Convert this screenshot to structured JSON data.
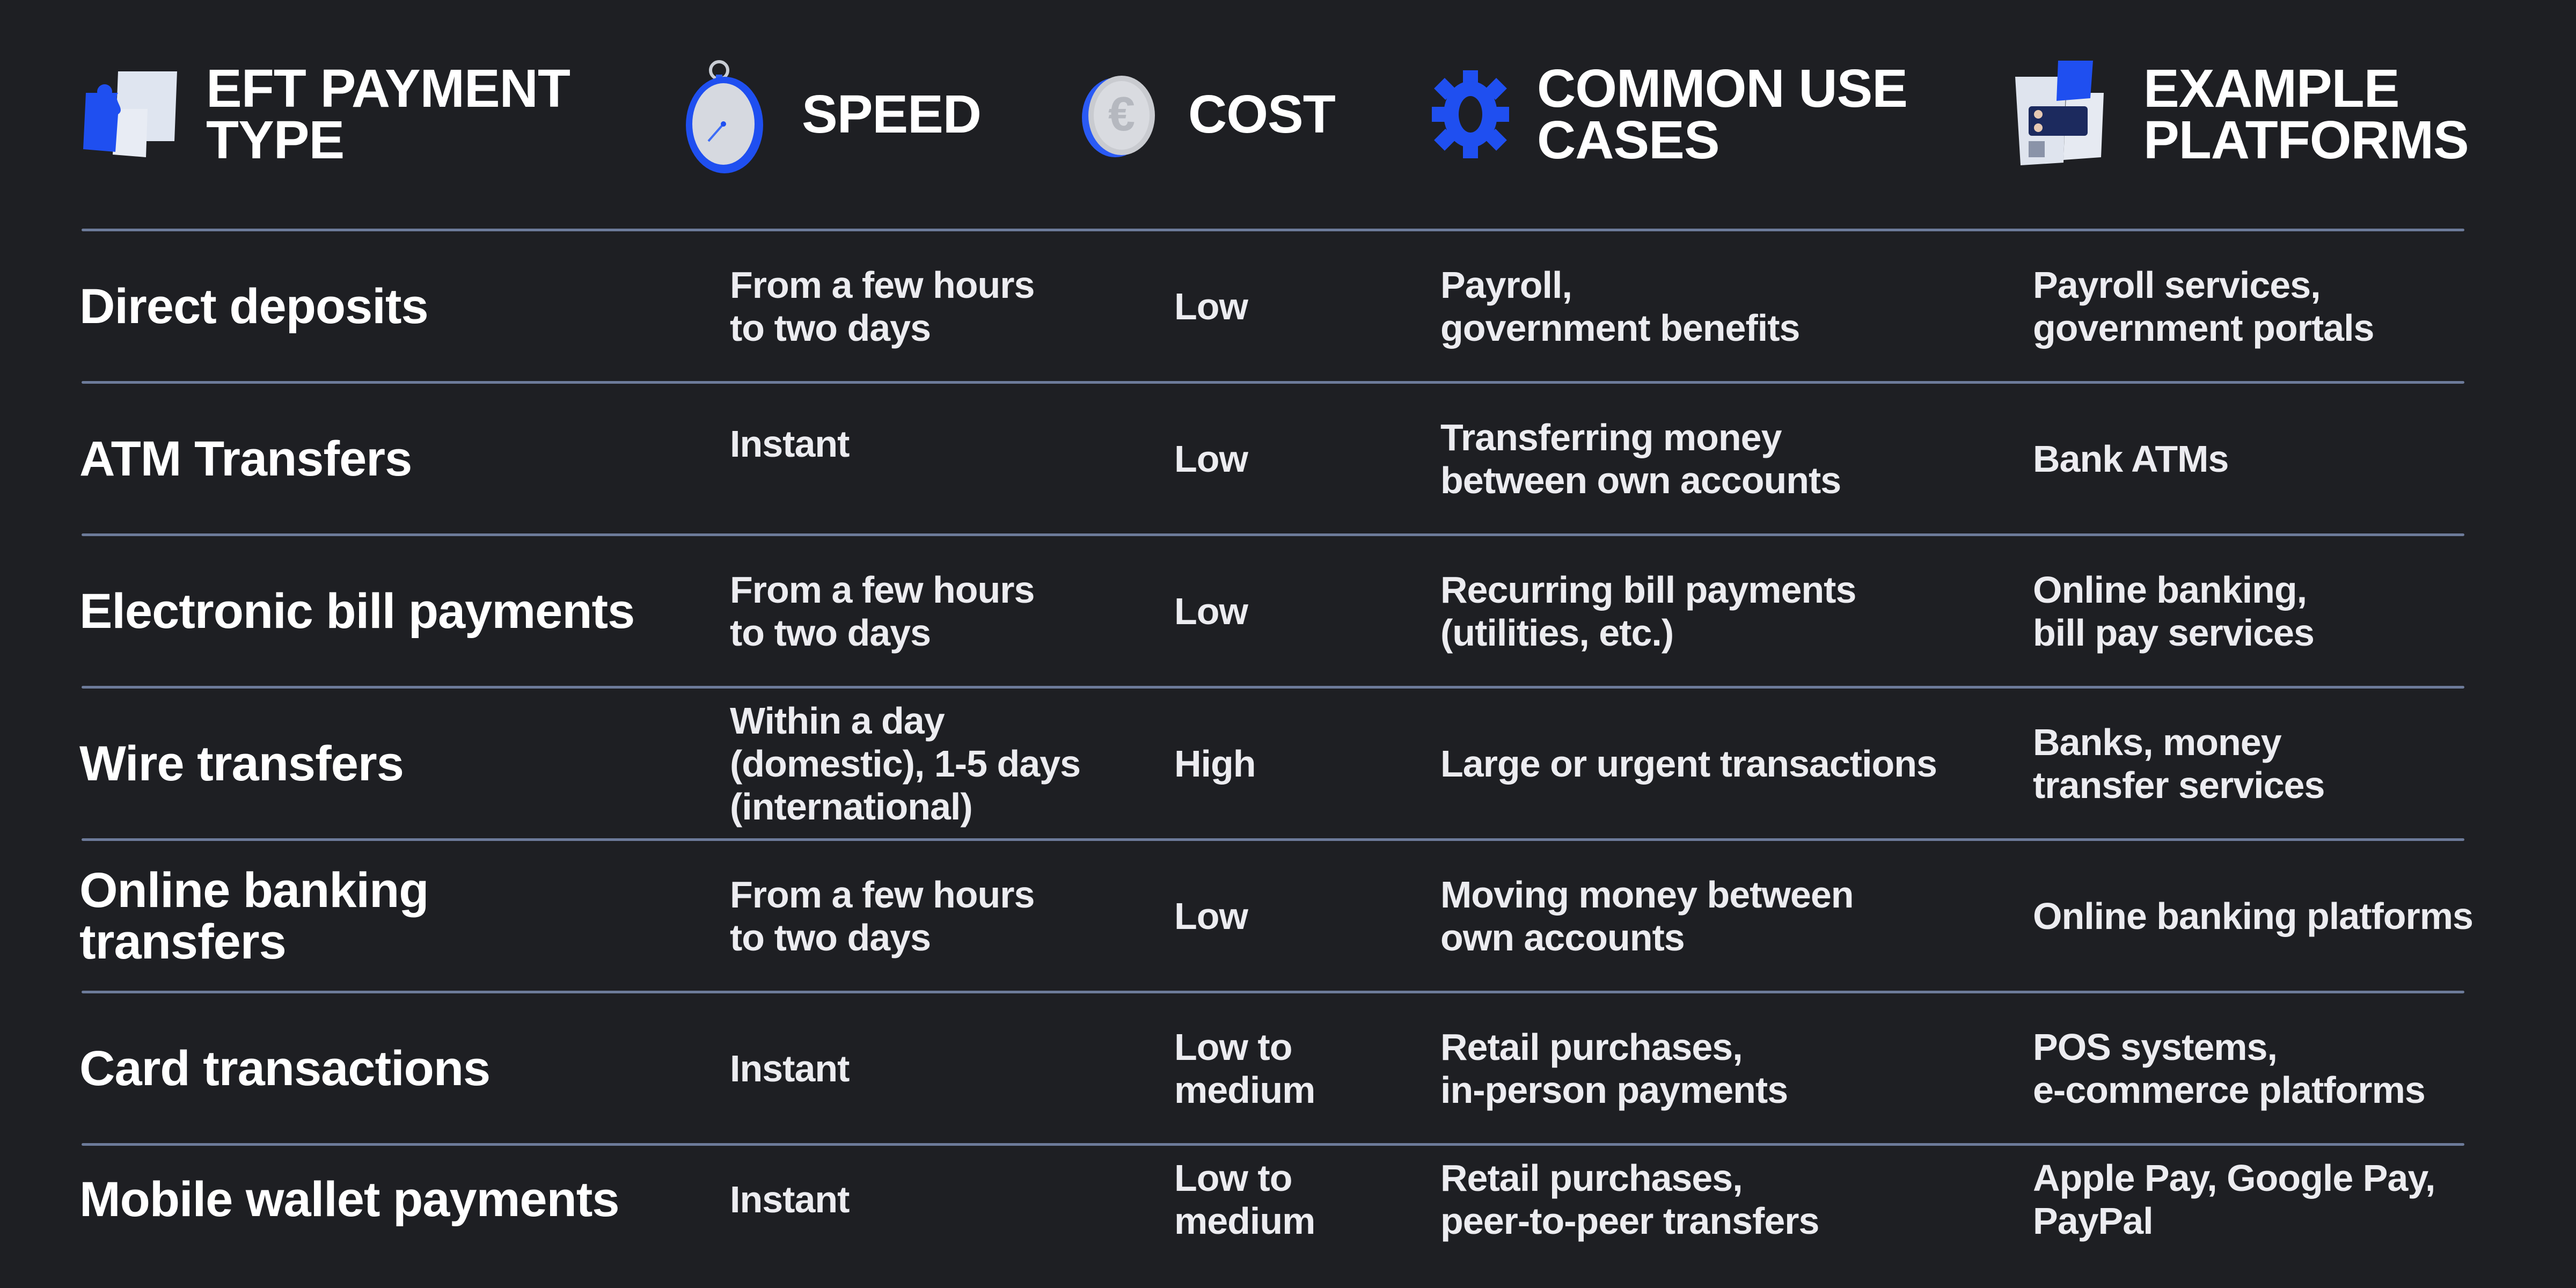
{
  "header": {
    "columns": [
      {
        "label": "EFT PAYMENT\nTYPE",
        "icon": "puzzle-icon"
      },
      {
        "label": "SPEED",
        "icon": "stopwatch-icon"
      },
      {
        "label": "COST",
        "icon": "euro-coin-icon"
      },
      {
        "label": "COMMON USE\nCASES",
        "icon": "gear-icon"
      },
      {
        "label": "EXAMPLE\nPLATFORMS",
        "icon": "platforms-puzzle-icon"
      }
    ]
  },
  "colors": {
    "background": "#1e1f23",
    "divider": "#6d7b9a",
    "accent_blue": "#1f4ff0",
    "text": "#ececf0"
  },
  "rows": [
    {
      "type": "Direct deposits",
      "speed": "From a few hours\nto two days",
      "cost": "Low",
      "use_cases": "Payroll,\ngovernment benefits",
      "platforms": "Payroll services,\ngovernment portals"
    },
    {
      "type": "ATM Transfers",
      "speed": "Instant",
      "cost": "Low",
      "use_cases": "Transferring money\nbetween own accounts",
      "platforms": "Bank ATMs"
    },
    {
      "type": "Electronic bill payments",
      "speed": "From a few hours\nto two days",
      "cost": "Low",
      "use_cases": "Recurring bill payments\n(utilities, etc.)",
      "platforms": "Online banking,\nbill pay services"
    },
    {
      "type": "Wire transfers",
      "speed": "Within a day\n(domestic), 1-5 days\n(international)",
      "cost": "High",
      "use_cases": "Large or urgent transactions",
      "platforms": "Banks, money\ntransfer services"
    },
    {
      "type": "Online banking\ntransfers",
      "speed": "From a few hours\nto two days",
      "cost": "Low",
      "use_cases": "Moving money between\nown accounts",
      "platforms": "Online banking platforms"
    },
    {
      "type": "Card transactions",
      "speed": "Instant",
      "cost": "Low to\nmedium",
      "use_cases": "Retail purchases,\nin-person payments",
      "platforms": "POS systems,\ne-commerce platforms"
    },
    {
      "type": "Mobile wallet payments",
      "speed": "Instant",
      "cost": "Low to\nmedium",
      "use_cases": "Retail purchases,\npeer-to-peer transfers",
      "platforms": "Apple Pay, Google Pay,\nPayPal"
    }
  ]
}
